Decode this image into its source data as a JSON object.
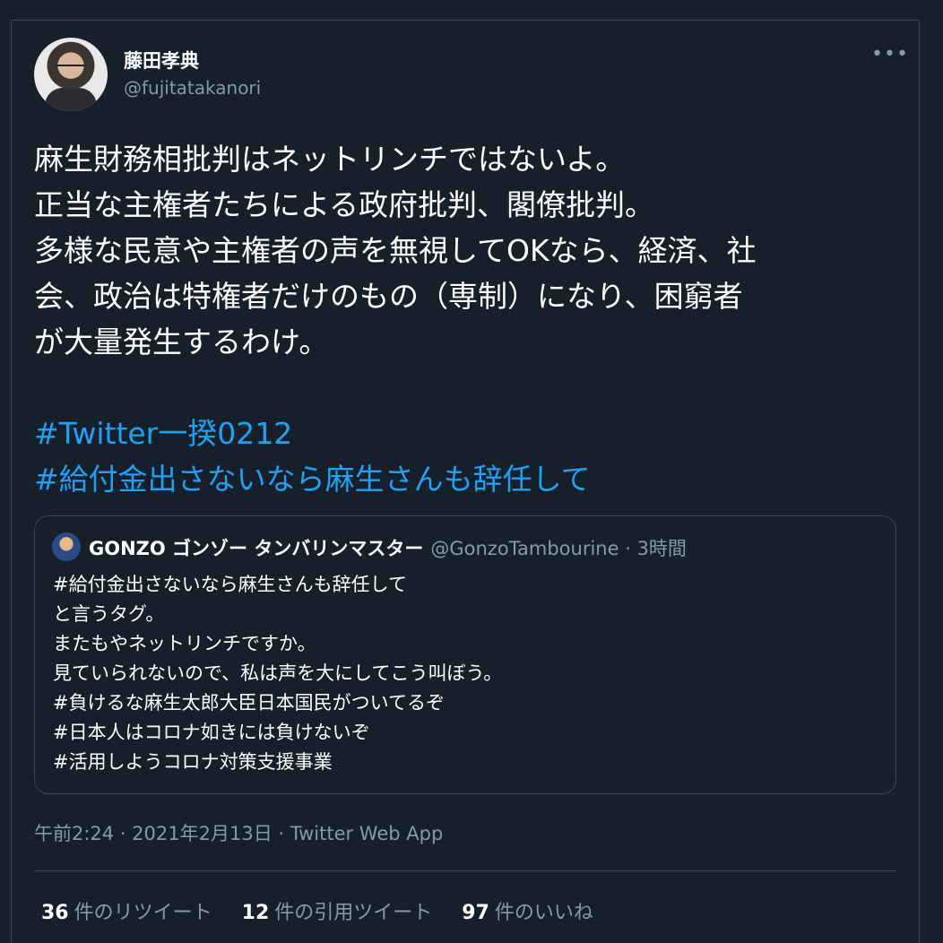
{
  "tweet": {
    "author": {
      "name": "藤田孝典",
      "handle": "@fujitatakanori"
    },
    "more_icon": "more-horizontal-icon",
    "body_lines": [
      "麻生財務相批判はネットリンチではないよ。",
      "正当な主権者たちによる政府批判、閣僚批判。",
      "多様な民意や主権者の声を無視してOKなら、経済、社",
      "会、政治は特権者だけのもの（専制）になり、困窮者",
      "が大量発生するわけ。"
    ],
    "hashtags": [
      "#Twitter一揆0212",
      "#給付金出さないなら麻生さんも辞任して"
    ],
    "timestamp": "午前2:24 · 2021年2月13日 · Twitter Web App",
    "stats": {
      "retweets": {
        "count": "36",
        "label": "件のリツイート"
      },
      "quotes": {
        "count": "12",
        "label": "件の引用ツイート"
      },
      "likes": {
        "count": "97",
        "label": "件のいいね"
      }
    }
  },
  "quoted_tweet": {
    "name": "GONZO ゴンゾー タンバリンマスター",
    "meta": "@GonzoTambourine · 3時間",
    "lines": [
      "#給付金出さないなら麻生さんも辞任して",
      "と言うタグ。",
      "またもやネットリンチですか。",
      "見ていられないので、私は声を大にしてこう叫ぼう。",
      "#負けるな麻生太郎大臣日本国民がついてるぞ",
      "#日本人はコロナ如きには負けないぞ",
      "#活用しようコロナ対策支援事業"
    ]
  },
  "colors": {
    "background": "#15202b",
    "text": "#ffffff",
    "secondary": "#8899a6",
    "link": "#1da1f2",
    "border": "#38444d"
  }
}
